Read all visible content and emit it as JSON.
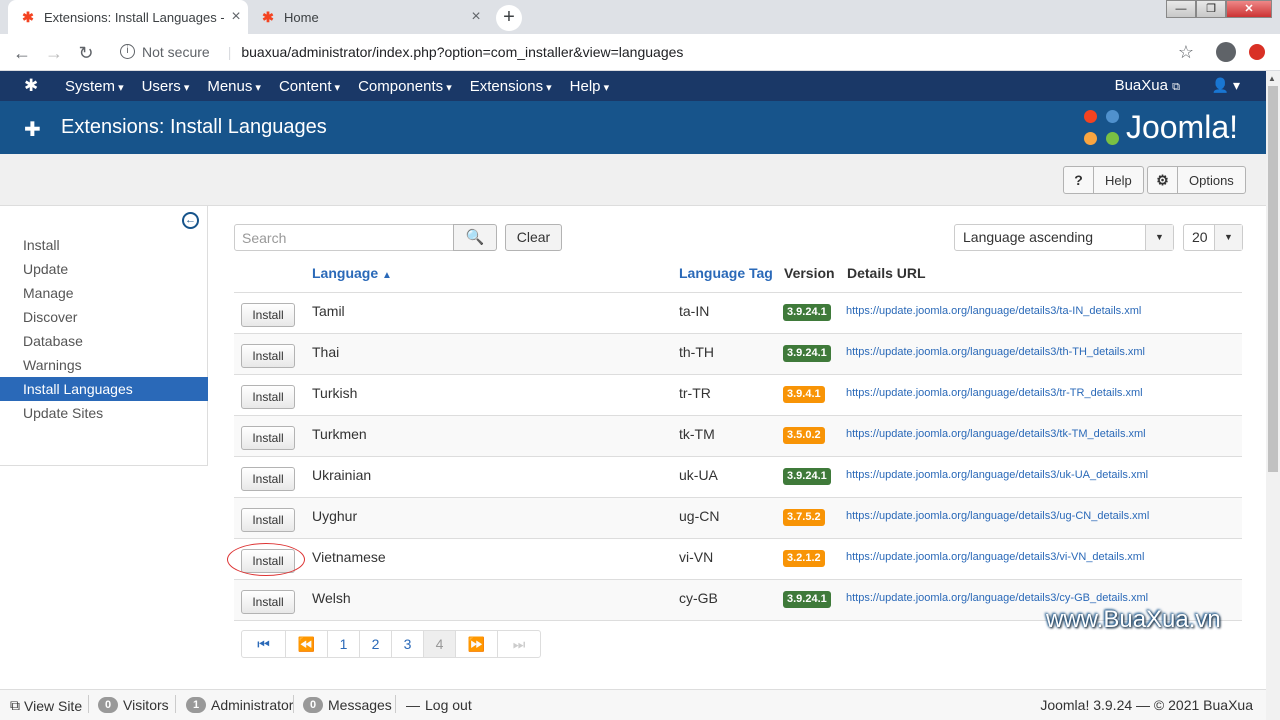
{
  "browser": {
    "tabs": [
      {
        "title": "Extensions: Install Languages - BuaXua",
        "active": true
      },
      {
        "title": "Home",
        "active": false
      }
    ],
    "address": {
      "security": "Not secure",
      "url": "buaxua/administrator/index.php?option=com_installer&view=languages"
    }
  },
  "topnav": {
    "menu": [
      "System",
      "Users",
      "Menus",
      "Content",
      "Components",
      "Extensions",
      "Help"
    ],
    "site_link": "BuaXua"
  },
  "header": {
    "title": "Extensions: Install Languages",
    "brand": "Joomla!"
  },
  "toolbar": {
    "help_label": "Help",
    "options_label": "Options"
  },
  "sidebar": {
    "items": [
      "Install",
      "Update",
      "Manage",
      "Discover",
      "Database",
      "Warnings",
      "Install Languages",
      "Update Sites"
    ],
    "active": "Install Languages"
  },
  "filters": {
    "search_placeholder": "Search",
    "clear_label": "Clear",
    "ordering": "Language ascending",
    "limit": "20"
  },
  "table": {
    "headers": {
      "language": "Language",
      "tag": "Language Tag",
      "version": "Version",
      "url": "Details URL"
    },
    "install_label": "Install",
    "rows": [
      {
        "language": "Tamil",
        "tag": "ta-IN",
        "version": "3.9.24.1",
        "status": "current",
        "url": "https://update.joomla.org/language/details3/ta-IN_details.xml"
      },
      {
        "language": "Thai",
        "tag": "th-TH",
        "version": "3.9.24.1",
        "status": "current",
        "url": "https://update.joomla.org/language/details3/th-TH_details.xml"
      },
      {
        "language": "Turkish",
        "tag": "tr-TR",
        "version": "3.9.4.1",
        "status": "outdated",
        "url": "https://update.joomla.org/language/details3/tr-TR_details.xml"
      },
      {
        "language": "Turkmen",
        "tag": "tk-TM",
        "version": "3.5.0.2",
        "status": "outdated",
        "url": "https://update.joomla.org/language/details3/tk-TM_details.xml"
      },
      {
        "language": "Ukrainian",
        "tag": "uk-UA",
        "version": "3.9.24.1",
        "status": "current",
        "url": "https://update.joomla.org/language/details3/uk-UA_details.xml"
      },
      {
        "language": "Uyghur",
        "tag": "ug-CN",
        "version": "3.7.5.2",
        "status": "outdated",
        "url": "https://update.joomla.org/language/details3/ug-CN_details.xml"
      },
      {
        "language": "Vietnamese",
        "tag": "vi-VN",
        "version": "3.2.1.2",
        "status": "outdated",
        "url": "https://update.joomla.org/language/details3/vi-VN_details.xml"
      },
      {
        "language": "Welsh",
        "tag": "cy-GB",
        "version": "3.9.24.1",
        "status": "current",
        "url": "https://update.joomla.org/language/details3/cy-GB_details.xml"
      }
    ]
  },
  "pagination": {
    "pages": [
      "1",
      "2",
      "3",
      "4"
    ],
    "current": "4"
  },
  "watermark": "www.BuaXua.vn",
  "statusbar": {
    "view_site": "View Site",
    "visitors_count": "0",
    "visitors_label": "Visitors",
    "admin_count": "1",
    "admin_label": "Administrator",
    "messages_count": "0",
    "messages_label": "Messages",
    "logout": "Log out",
    "footer": "Joomla! 3.9.24 — © 2021 BuaXua"
  },
  "colors": {
    "navy": "#1a3867",
    "header_blue": "#17548b",
    "link": "#2a69b8",
    "badge_current": "#3f7a3a",
    "badge_outdated": "#f89406"
  }
}
